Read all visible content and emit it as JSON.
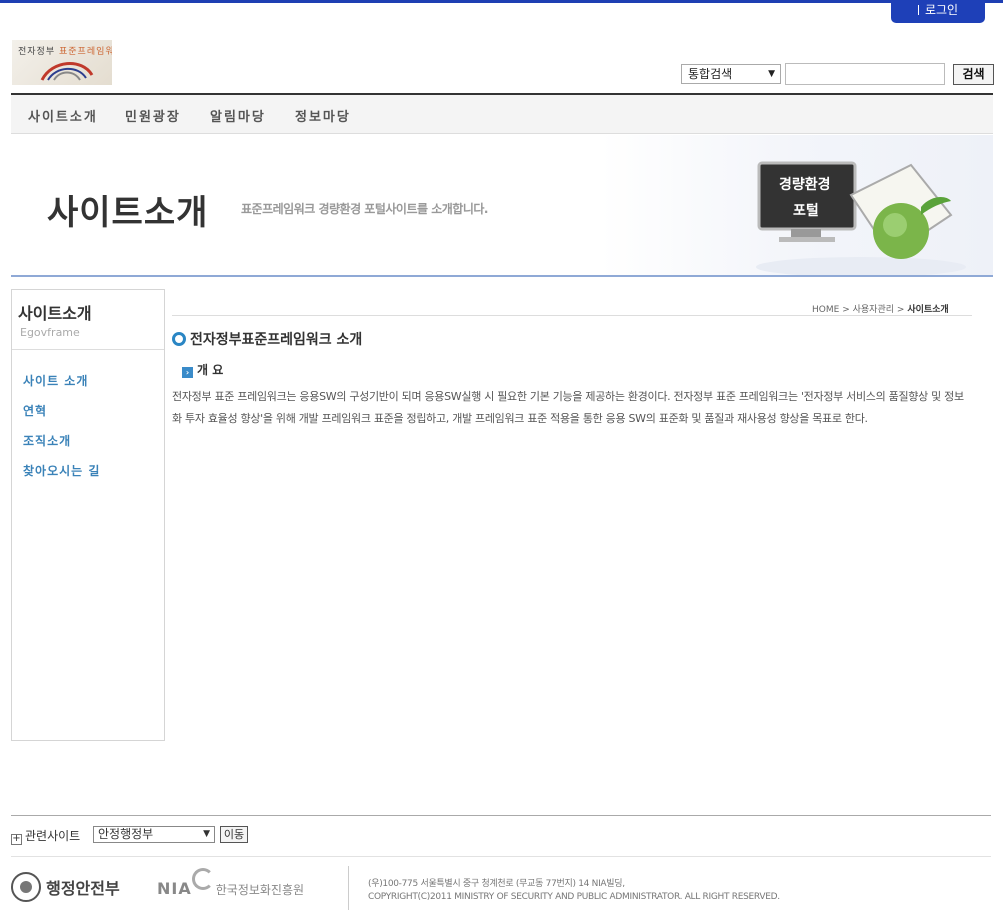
{
  "header": {
    "login_label": "로그인",
    "logo_text_a": "전자정부",
    "logo_text_b": "표준프레임워크",
    "search_select": "통합검색",
    "search_value": "",
    "search_button": "검색"
  },
  "gnb": [
    {
      "label": "사이트소개"
    },
    {
      "label": "민원광장"
    },
    {
      "label": "알림마당"
    },
    {
      "label": "정보마당"
    }
  ],
  "banner": {
    "title": "사이트소개",
    "subtitle": "표준프레임워크 경량환경 포털사이트를 소개합니다.",
    "art_line1": "경량환경",
    "art_line2": "포털"
  },
  "sidebar": {
    "title": "사이트소개",
    "subtitle": "Egovframe",
    "items": [
      {
        "label": "사이트 소개"
      },
      {
        "label": "연혁"
      },
      {
        "label": "조직소개"
      },
      {
        "label": "찾아오시는 길"
      }
    ]
  },
  "breadcrumb": {
    "home": "HOME",
    "sep": ">",
    "mid": "사용자관리",
    "current": "사이트소개"
  },
  "content": {
    "title": "전자정부표준프레임워크 소개",
    "section": "개 요",
    "description": "전자정부 표준 프레임워크는 응용SW의 구성기반이 되며 응용SW실행 시 필요한 기본 기능을 제공하는 환경이다. 전자정부 표준 프레임워크는 '전자정부 서비스의 품질향상 및 정보화 투자 효율성 향상'을 위해 개발 프레임워크 표준을 정립하고, 개발 프레임워크 표준 적용을 통한 응용 SW의 표준화 및 품질과 재사용성 향상을 목표로 한다."
  },
  "footer": {
    "related_label": "관련사이트",
    "related_select": "안정행정부",
    "move_button": "이동",
    "mopas_name": "행정안전부",
    "nia_name": "NIA",
    "nia_kor": "한국정보화진흥원",
    "address_line1": "(우)100-775 서울특별시 중구 청계천로 (무교동 77번지) 14 NIA빌딩,",
    "address_line2": "COPYRIGHT(C)2011 MINISTRY OF SECURITY AND PUBLIC ADMINISTRATOR. ALL RIGHT RESERVED."
  },
  "colors": {
    "accent_blue": "#1e40b8",
    "link_blue": "#3a82b8",
    "banner_border": "#8fa9d6"
  }
}
